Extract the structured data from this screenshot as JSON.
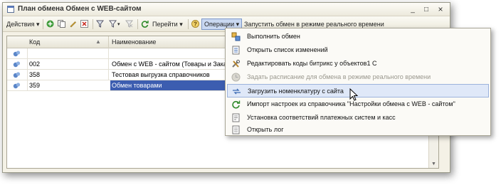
{
  "window": {
    "title": "План обмена Обмен с WEB-сайтом",
    "controls": {
      "minimize": "_",
      "maximize": "□",
      "close": "×"
    }
  },
  "toolbar": {
    "actions_label": "Действия",
    "goto_label": "Перейти",
    "operations_label": "Операции",
    "realtime_label": "Запустить обмен в режиме реального времени"
  },
  "table": {
    "columns": [
      "Код",
      "Наименование"
    ],
    "rows": [
      {
        "code": "",
        "name": ""
      },
      {
        "code": "002",
        "name": "Обмен с WEB - сайтом (Товары и Заказ"
      },
      {
        "code": "358",
        "name": "Тестовая выгрузка справочников"
      },
      {
        "code": "359",
        "name": "Обмен товарами"
      }
    ]
  },
  "menu": {
    "items": [
      {
        "label": "Выполнить обмен",
        "icon": "exchange-icon",
        "disabled": false
      },
      {
        "label": "Открыть список изменений",
        "icon": "list-icon",
        "disabled": false
      },
      {
        "label": "Редактировать коды битрикс у объектов1 С",
        "icon": "tools-icon",
        "disabled": false
      },
      {
        "label": "Задать расписание для обмена в режиме реального времени",
        "icon": "schedule-icon",
        "disabled": true
      },
      {
        "label": "Загрузить номенклатуру с сайта",
        "icon": "download-icon",
        "disabled": false,
        "hover": true
      },
      {
        "label": "Импорт настроек из справочника \"Настройки обмена с WEB - сайтом\"",
        "icon": "refresh-icon",
        "disabled": false
      },
      {
        "label": "Установка соответствий платежных систем и касс",
        "icon": "document-icon",
        "disabled": false
      },
      {
        "label": "Открыть лог",
        "icon": "log-icon",
        "disabled": false
      }
    ]
  },
  "colors": {
    "selection": "#3c5db0",
    "menu_hover": "#dfe8f8",
    "ops_button": "#c9d8f1"
  }
}
